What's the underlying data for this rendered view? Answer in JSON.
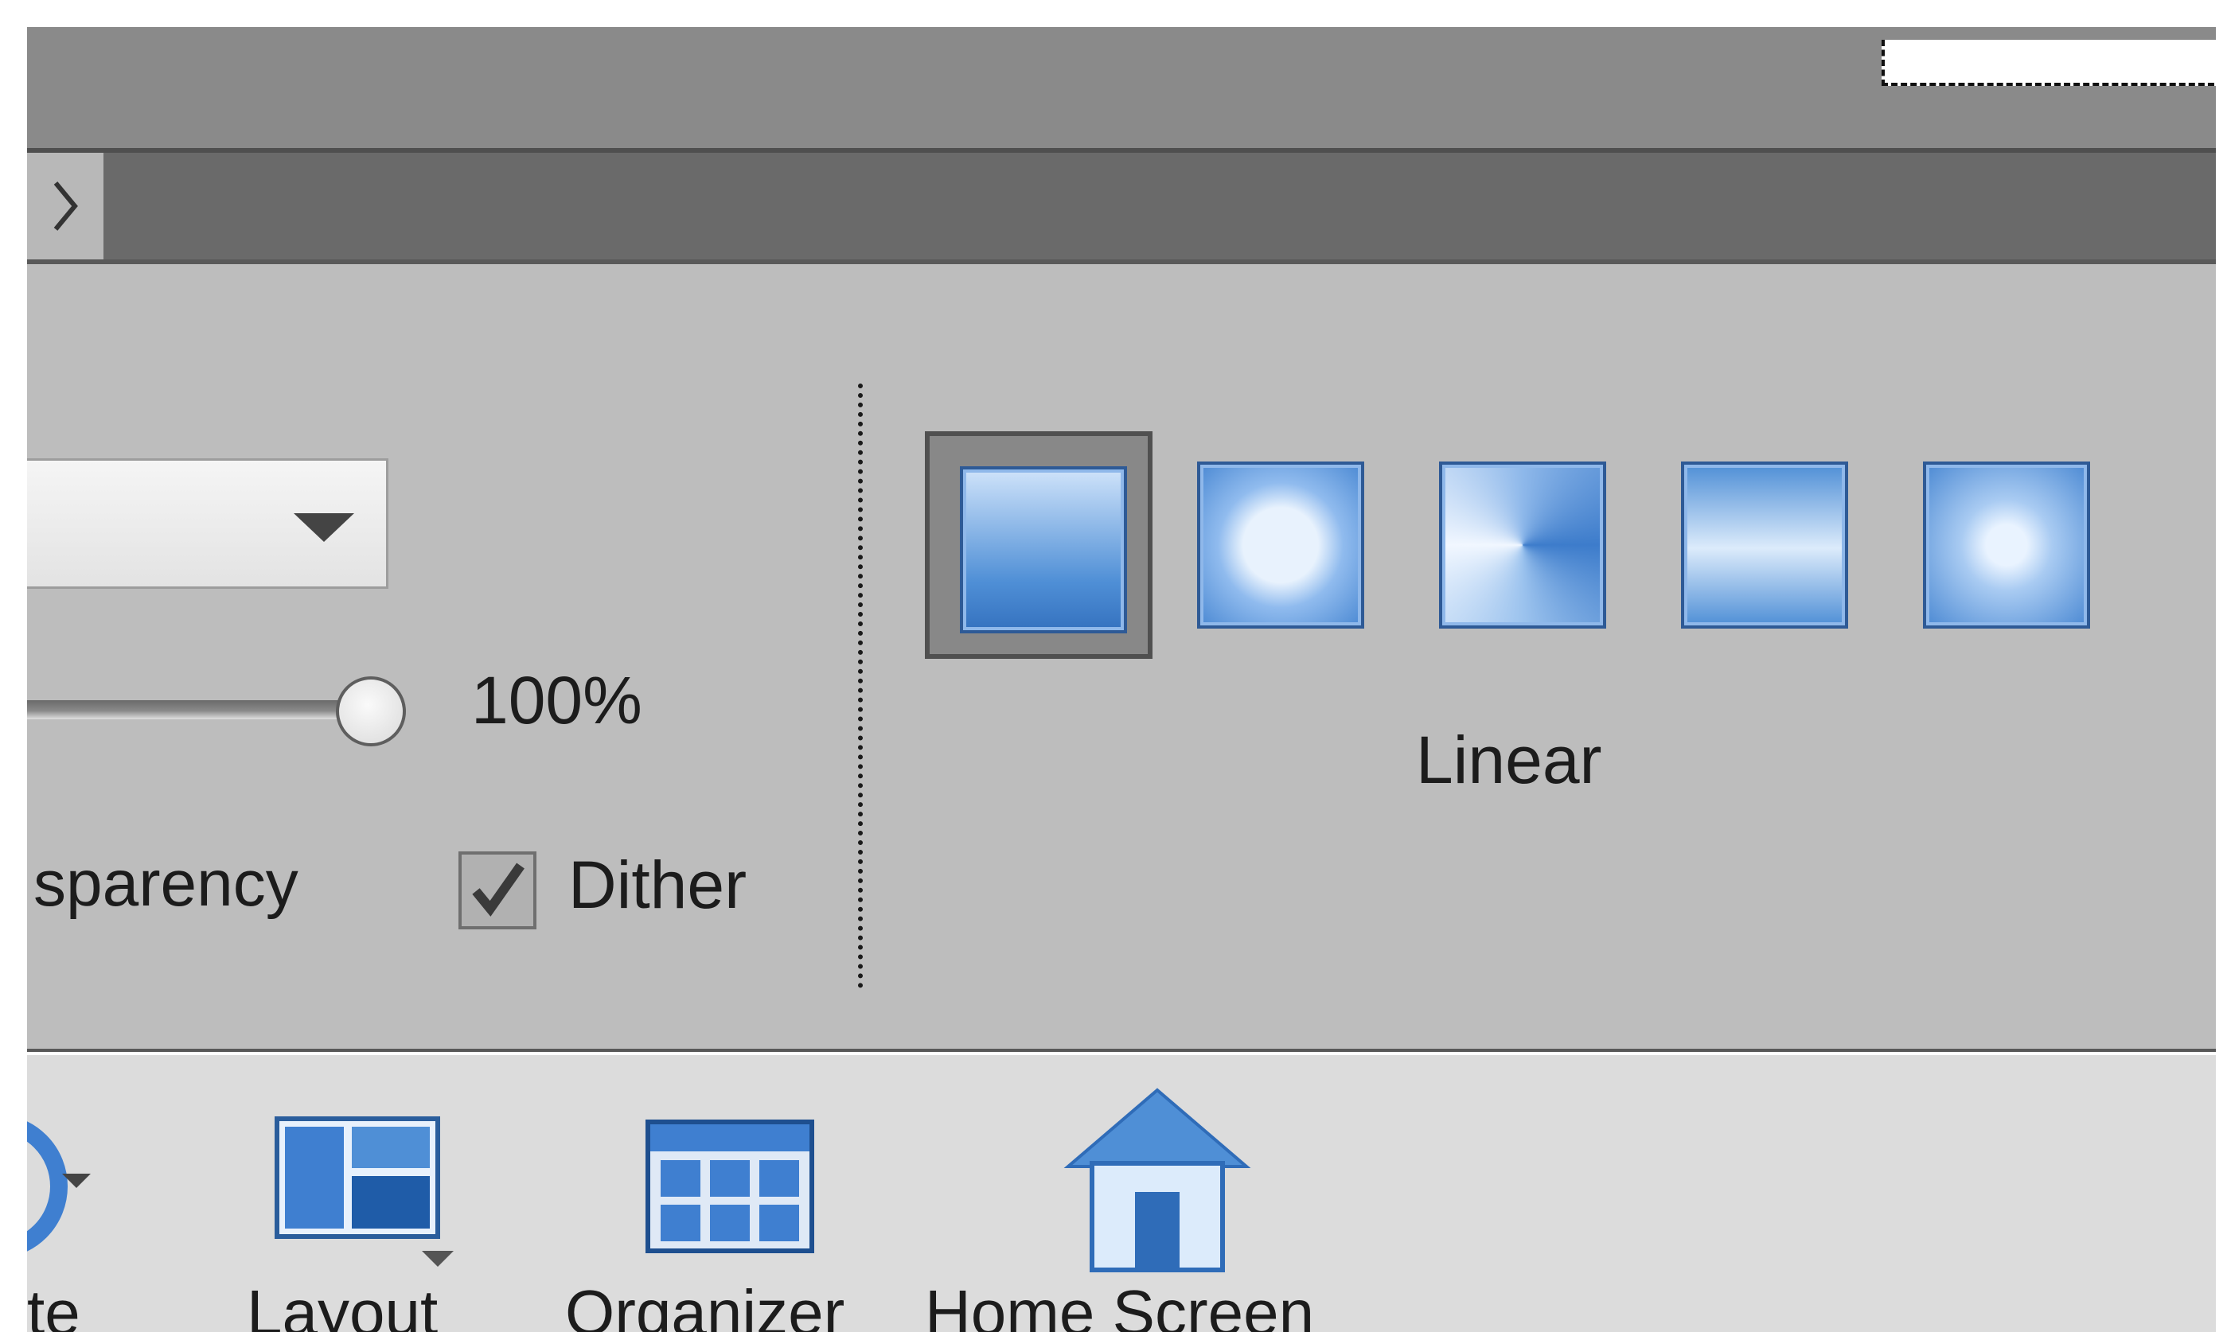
{
  "options_panel": {
    "opacity_value": "100%",
    "transparency_label": "sparency",
    "dither_label": "Dither",
    "dither_checked": true,
    "gradient_style_selected": "Linear",
    "gradient_styles": [
      "linear-gradient-icon",
      "radial-gradient-icon",
      "angle-gradient-icon",
      "reflected-gradient-icon",
      "diamond-gradient-icon"
    ]
  },
  "taskbar": {
    "rotate_label": "te",
    "layout_label": "Layout",
    "organizer_label": "Organizer",
    "home_label": "Home Screen"
  },
  "colors": {
    "accent_blue": "#3f7fd0",
    "panel_gray": "#bdbdbd",
    "taskbar_gray": "#dcdcdc"
  }
}
